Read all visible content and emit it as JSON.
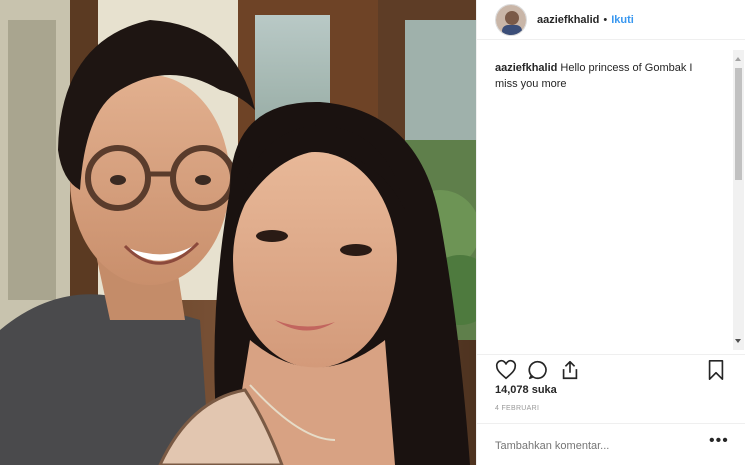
{
  "post": {
    "username": "aaziefkhalid",
    "separator": "•",
    "follow_label": "Ikuti",
    "caption_user": "aaziefkhalid",
    "caption_text": "Hello princess of Gombak I miss you more",
    "likes_text": "14,078 suka",
    "date_text": "4 FEBRUARI",
    "comment_placeholder": "Tambahkan komentar...",
    "more_label": "•••"
  },
  "icons": {
    "like": "heart-icon",
    "comment": "comment-bubble-icon",
    "share": "share-icon",
    "save": "bookmark-icon",
    "options": "more-options-icon"
  },
  "colors": {
    "link_blue": "#3897f0",
    "text": "#262626",
    "muted": "#999999",
    "border": "#efefef"
  }
}
